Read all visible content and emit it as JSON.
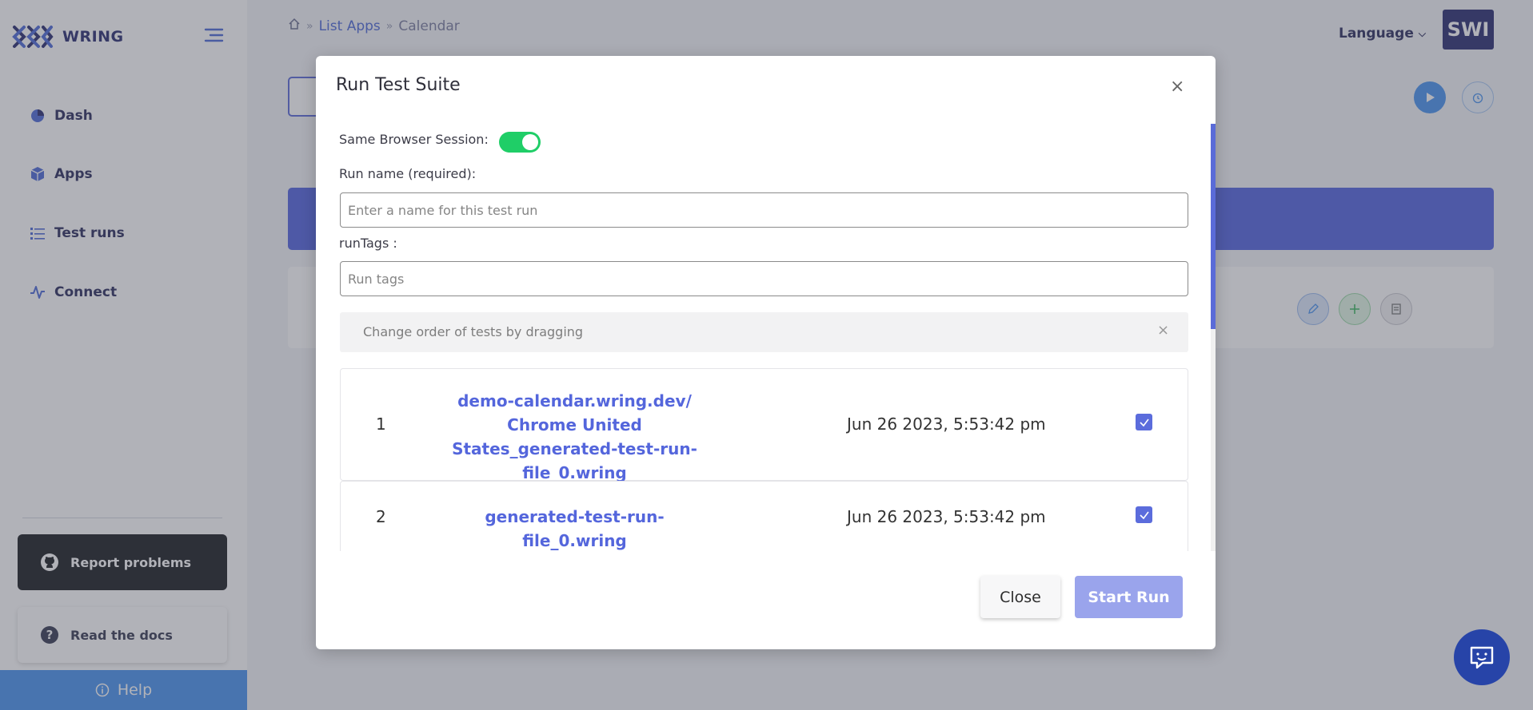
{
  "app": {
    "brand": "WRING",
    "avatar": "SWI",
    "language_label": "Language"
  },
  "breadcrumb": {
    "items": [
      "List Apps",
      "Calendar"
    ]
  },
  "sidebar": {
    "items": [
      {
        "label": "Dash",
        "icon": "pie-chart-icon"
      },
      {
        "label": "Apps",
        "icon": "cube-icon"
      },
      {
        "label": "Test runs",
        "icon": "list-icon"
      },
      {
        "label": "Connect",
        "icon": "activity-icon"
      }
    ],
    "report_label": "Report problems",
    "docs_label": "Read the docs",
    "help_label": "Help"
  },
  "modal": {
    "title": "Run Test Suite",
    "same_session_label": "Same Browser Session:",
    "same_session_on": true,
    "run_name_label": "Run name (required):",
    "run_name_placeholder": "Enter a name for this test run",
    "run_tags_label": "runTags :",
    "run_tags_placeholder": "Run tags",
    "drag_hint": "Change order of tests by dragging",
    "tests": [
      {
        "index": "1",
        "name": "demo-calendar.wring.dev/ Chrome United States_generated-test-run-file_0.wring",
        "date": "Jun 26 2023, 5:53:42 pm",
        "checked": true
      },
      {
        "index": "2",
        "name": "generated-test-run-file_0.wring",
        "date": "Jun 26 2023, 5:53:42 pm",
        "checked": true
      }
    ],
    "close_label": "Close",
    "start_label": "Start Run"
  },
  "colors": {
    "accent": "#5466dc",
    "navy": "#2b2f72",
    "toggle": "#1fce67",
    "help": "#4a95f0"
  }
}
